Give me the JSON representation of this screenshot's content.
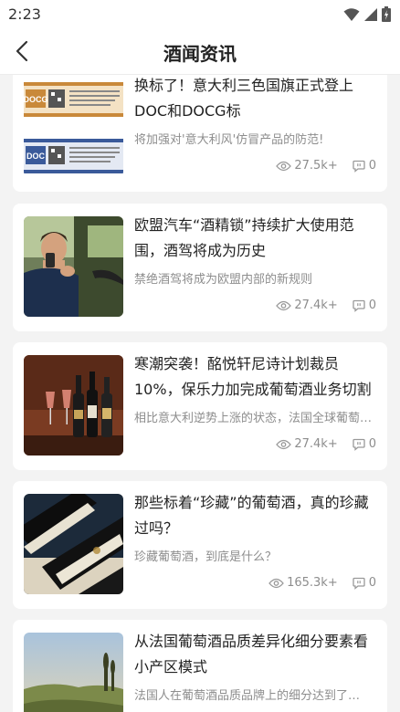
{
  "status_bar": {
    "time": "2:23"
  },
  "header": {
    "title": "酒闻资讯"
  },
  "articles": [
    {
      "title": "换标了！意大利三色国旗正式登上DOC和DOCG标",
      "summary": "将加强对'意大利风'仿冒产品的防范!",
      "views": "27.5k+",
      "comments": "0"
    },
    {
      "title": "欧盟汽车“酒精锁”持续扩大使用范围，酒驾将成为历史",
      "summary": "禁绝酒驾将成为欧盟内部的新规则",
      "views": "27.4k+",
      "comments": "0"
    },
    {
      "title": "寒潮突袭！酩悦轩尼诗计划裁员10%，保乐力加完成葡萄酒业务切割",
      "summary": "相比意大利逆势上涨的状态，法国全球葡萄酒市场…",
      "views": "27.4k+",
      "comments": "0"
    },
    {
      "title": "那些标着“珍藏”的葡萄酒，真的珍藏过吗？",
      "summary": "珍藏葡萄酒，到底是什么？",
      "views": "165.3k+",
      "comments": "0"
    },
    {
      "title": "从法国葡萄酒品质差异化细分要素看小产区模式",
      "summary": "法国人在葡萄酒品质品牌上的细分达到了…",
      "views": "",
      "comments": ""
    }
  ],
  "thumb_labels": {
    "doc": "DOC",
    "docg": "DOCG"
  }
}
